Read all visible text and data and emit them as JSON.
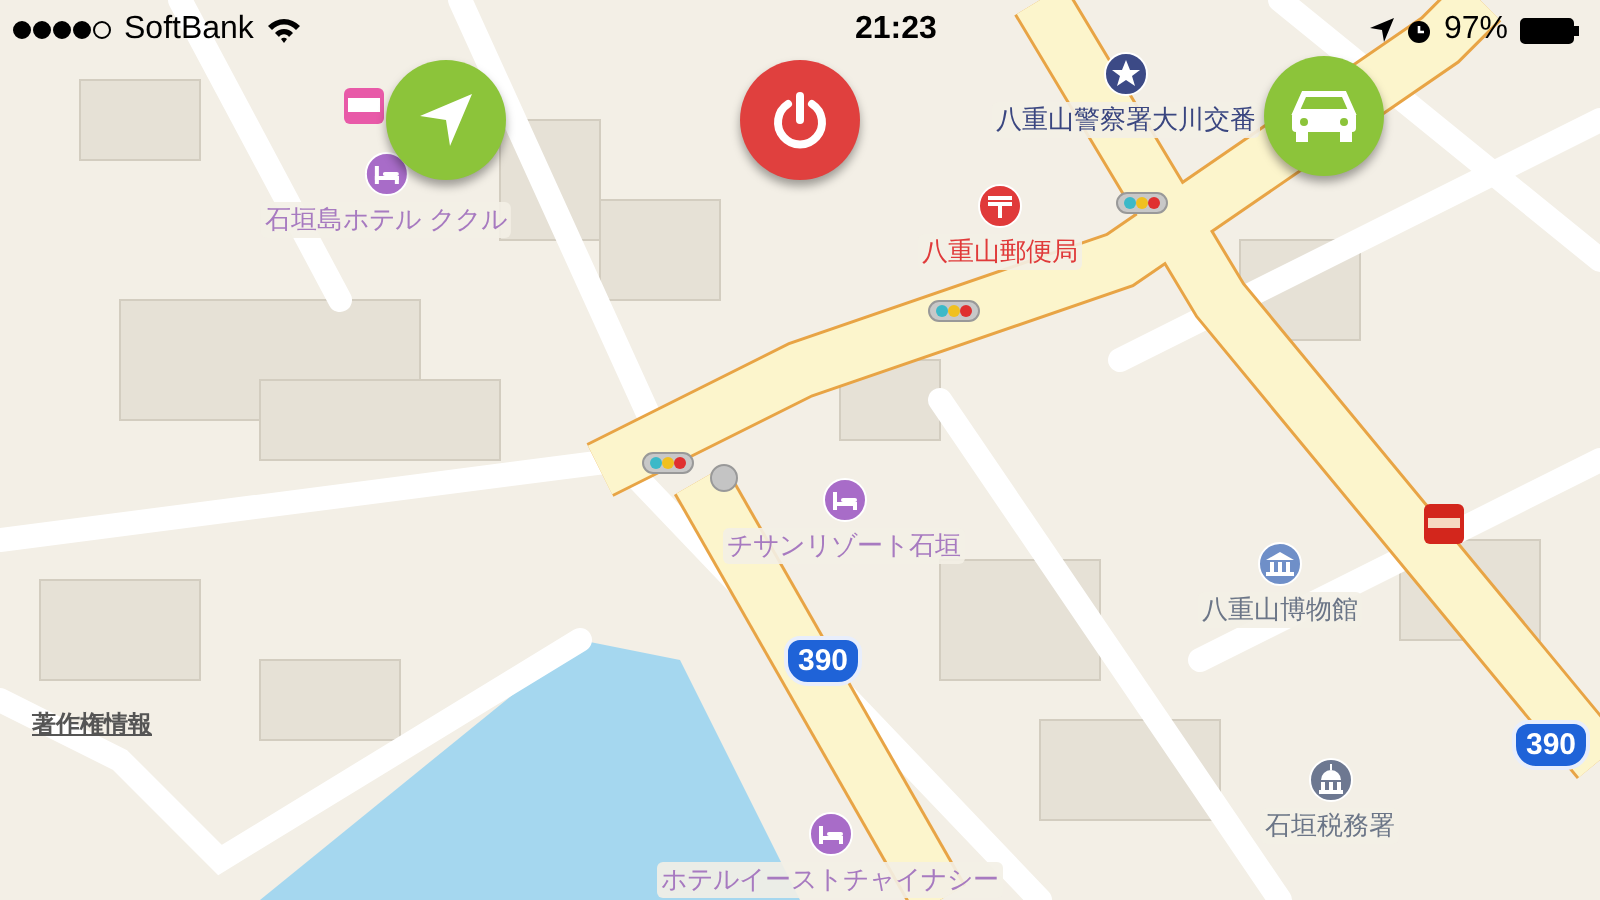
{
  "status_bar": {
    "carrier": "SoftBank",
    "time": "21:23",
    "battery": "97%"
  },
  "map": {
    "labels": [
      {
        "text": "石垣島ホテル ククル",
        "kind": "hotel"
      },
      {
        "text": "八重山警察署大川交番",
        "kind": "police"
      },
      {
        "text": "八重山郵便局",
        "kind": "post"
      },
      {
        "text": "チサンリゾート石垣",
        "kind": "hotel"
      },
      {
        "text": "八重山博物館",
        "kind": "museum"
      },
      {
        "text": "石垣税務署",
        "kind": "government"
      },
      {
        "text": "ホテルイーストチャイナシー",
        "kind": "hotel"
      }
    ],
    "route_shields": [
      "390",
      "390"
    ],
    "copyright_link": "著作権情報"
  },
  "buttons": [
    {
      "kind": "locate"
    },
    {
      "kind": "power"
    },
    {
      "kind": "car"
    }
  ]
}
